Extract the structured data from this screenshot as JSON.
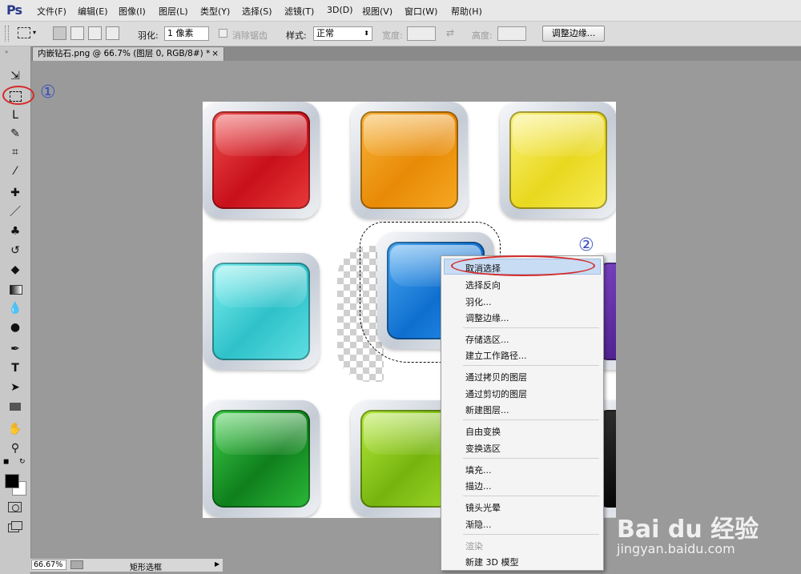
{
  "app": {
    "logo": "Ps"
  },
  "menu": [
    "文件(F)",
    "编辑(E)",
    "图像(I)",
    "图层(L)",
    "类型(Y)",
    "选择(S)",
    "滤镜(T)",
    "3D(D)",
    "视图(V)",
    "窗口(W)",
    "帮助(H)"
  ],
  "options": {
    "feather_label": "羽化:",
    "feather_value": "1 像素",
    "antialias_label": "消除锯齿",
    "style_label": "样式:",
    "style_value": "正常",
    "width_label": "宽度:",
    "height_label": "高度:",
    "refine_edge": "调整边缘..."
  },
  "document": {
    "tab_title": "内嵌钻石.png @ 66.7% (图层 0, RGB/8#) *",
    "close": "×"
  },
  "annotations": {
    "one": "①",
    "two": "②"
  },
  "context_menu": {
    "items": [
      "取消选择",
      "选择反向",
      "羽化...",
      "调整边缘...",
      "存储选区...",
      "建立工作路径...",
      "通过拷贝的图层",
      "通过剪切的图层",
      "新建图层...",
      "自由变换",
      "变换选区",
      "填充...",
      "描边...",
      "镜头光晕",
      "渐隐...",
      "渲染",
      "新建 3D 模型"
    ],
    "highlighted": "取消选择"
  },
  "status": {
    "zoom": "66.67%",
    "tool_name": "矩形选框"
  },
  "watermark": {
    "brand": "Bai du 经验",
    "url": "jingyan.baidu.com"
  },
  "colors": {
    "red": "#d61e1e",
    "orange": "#f39a12",
    "yellow": "#f0e23a",
    "cyan": "#3ec9cf",
    "blue": "#1f86e0",
    "green": "#1e9a2c",
    "lime": "#8fcc20",
    "purple": "#5a2a9a",
    "annotation": "#3a4fbf",
    "callout": "#d62a2a"
  },
  "icons": [
    "move-icon",
    "rect-marquee-icon",
    "lasso-icon",
    "quick-select-icon",
    "crop-icon",
    "eyedropper-icon",
    "healing-brush-icon",
    "brush-icon",
    "clone-stamp-icon",
    "history-brush-icon",
    "eraser-icon",
    "gradient-icon",
    "blur-icon",
    "dodge-icon",
    "pen-icon",
    "type-icon",
    "path-select-icon",
    "shape-icon",
    "hand-icon",
    "zoom-icon"
  ]
}
